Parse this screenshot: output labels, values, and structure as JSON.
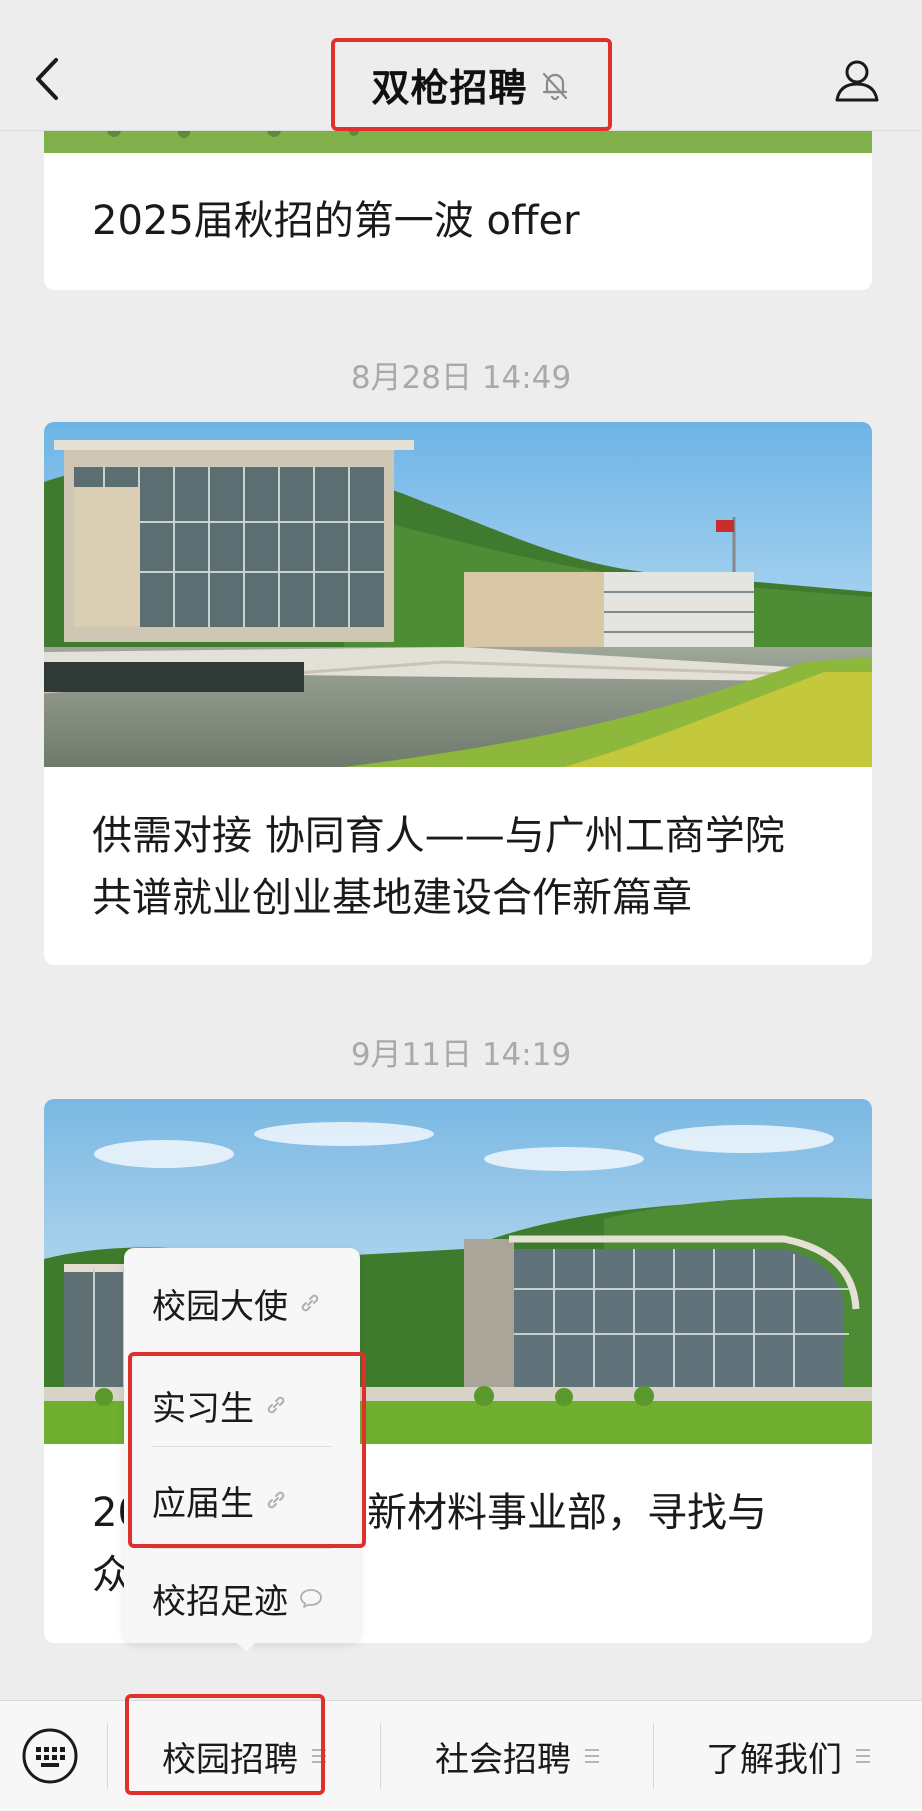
{
  "header": {
    "title": "双枪招聘"
  },
  "feed": {
    "card1_title": "2025届秋招的第一波 offer",
    "ts2": "8月28日 14:49",
    "card2_title_line1": "供需对接 协同育人——与广州工商学院",
    "card2_title_line2": "共谱就业创业基地建设合作新篇章",
    "ts3": "9月11日 14:19",
    "card3_title_line1_prefix": "20",
    "card3_title_line1_suffix": "新材料事业部，寻找与",
    "card3_title_line2_prefix": "众"
  },
  "popup_menu": {
    "items": [
      {
        "label": "校园大使",
        "icon": "link-icon"
      },
      {
        "label": "实习生",
        "icon": "link-icon"
      },
      {
        "label": "应届生",
        "icon": "link-icon"
      },
      {
        "label": "校招足迹",
        "icon": "chat-bubble-icon"
      }
    ]
  },
  "bottom_menu": {
    "keyboard_icon": "keyboard-icon",
    "items": [
      {
        "label": "校园招聘"
      },
      {
        "label": "社会招聘"
      },
      {
        "label": "了解我们"
      }
    ]
  },
  "colors": {
    "highlight": "#e0302d",
    "background": "#ededed"
  }
}
